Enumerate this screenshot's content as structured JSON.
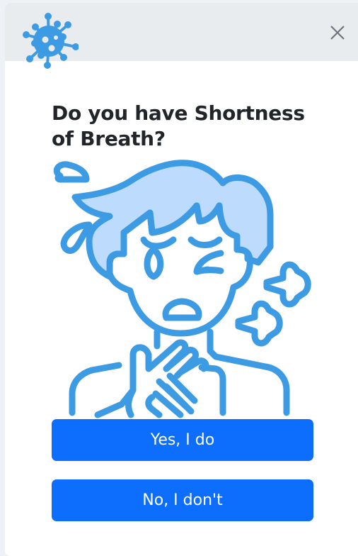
{
  "header": {
    "logo_icon": "virus-icon",
    "close_icon": "close-icon"
  },
  "question": {
    "title": "Do you have Shortness of Breath?"
  },
  "illustration": {
    "icon": "shortness-of-breath-person-icon",
    "stroke_color": "#3d9be3",
    "fill_color": "#bddcfd"
  },
  "buttons": {
    "yes_label": "Yes, I do",
    "no_label": "No, I don't",
    "color": "#0d6efd"
  }
}
